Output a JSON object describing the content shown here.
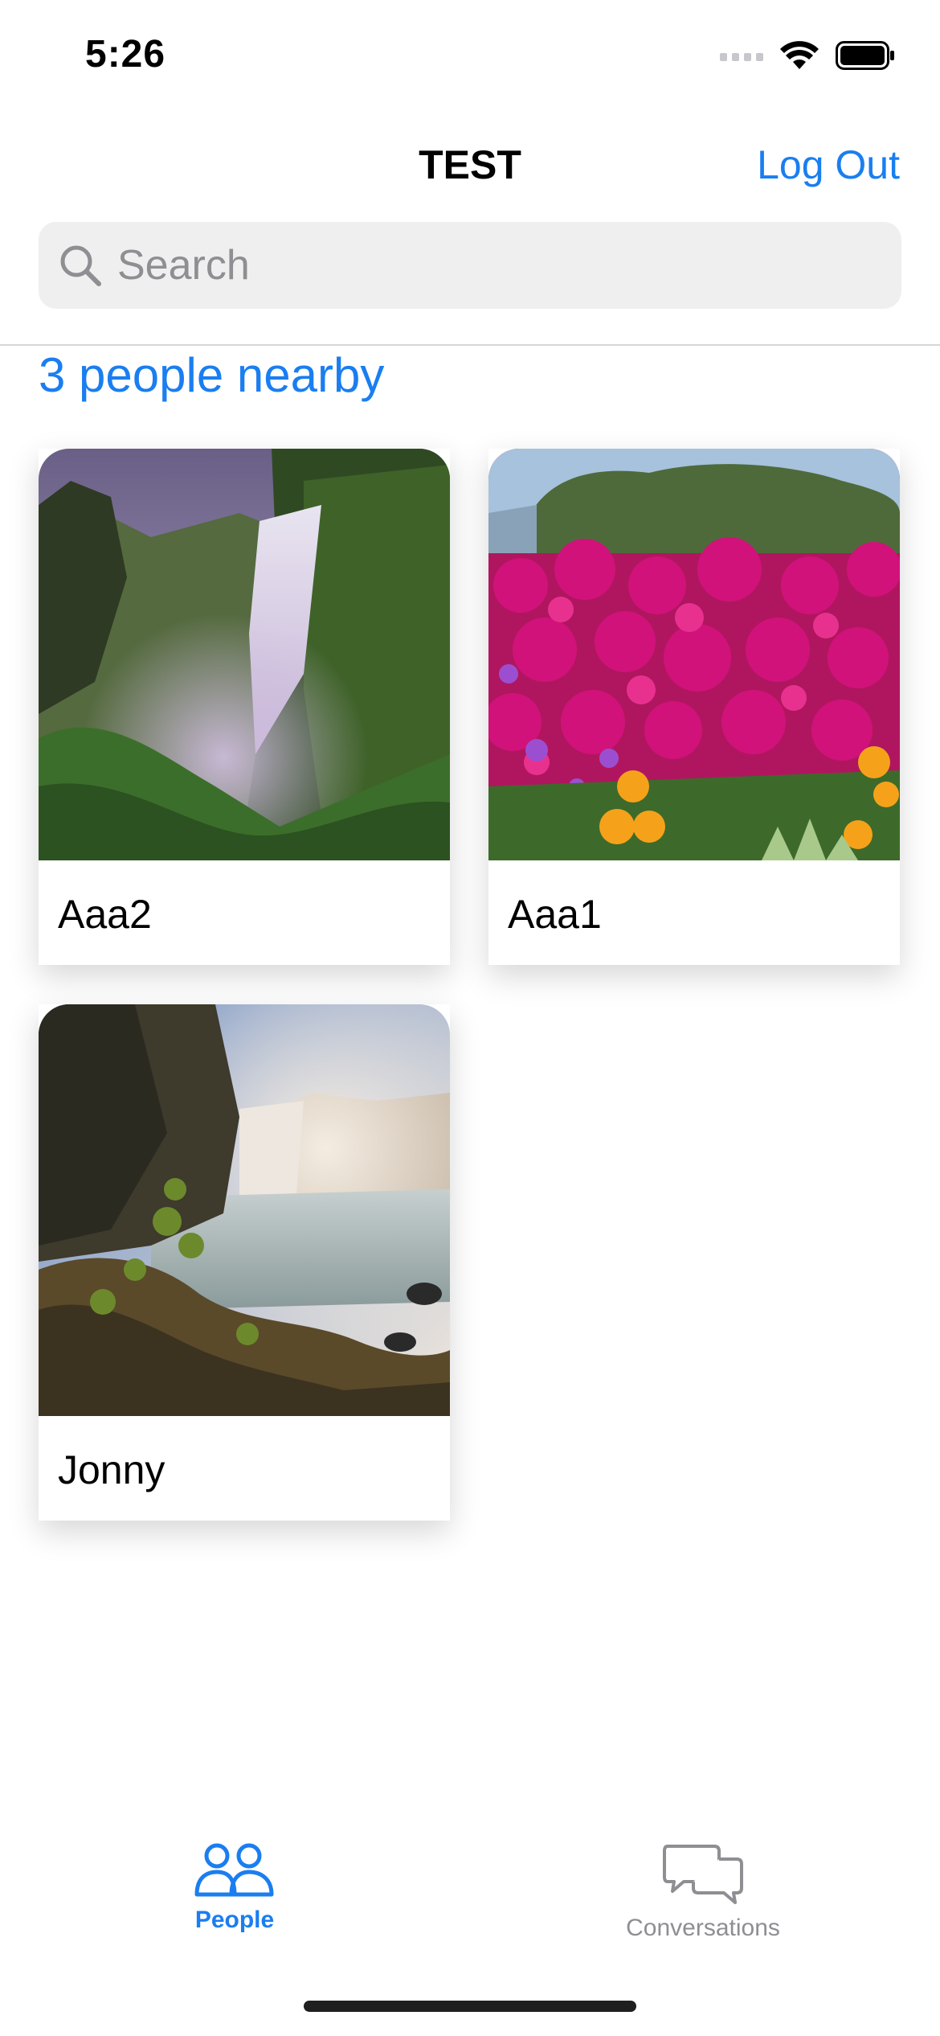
{
  "status": {
    "time": "5:26"
  },
  "nav": {
    "title": "TEST",
    "logout_label": "Log Out"
  },
  "search": {
    "placeholder": "Search"
  },
  "nearby_label": "3 people nearby",
  "people": [
    {
      "name": "Aaa2"
    },
    {
      "name": "Aaa1"
    },
    {
      "name": "Jonny"
    }
  ],
  "tabs": [
    {
      "label": "People",
      "icon": "people-icon",
      "active": true
    },
    {
      "label": "Conversations",
      "icon": "chat-bubbles-icon",
      "active": false
    }
  ],
  "colors": {
    "accent": "#1a7ef0",
    "inactive": "#8e8e93"
  }
}
